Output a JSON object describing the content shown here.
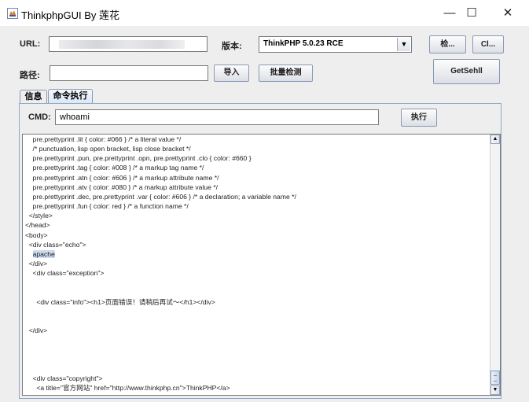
{
  "window": {
    "title": "ThinkphpGUI By 莲花",
    "minimize_glyph": "—",
    "maximize_glyph": "☐",
    "close_glyph": "✕"
  },
  "form": {
    "url_label": "URL:",
    "url_value": "",
    "version_label": "版本:",
    "version_selected": "ThinkPHP 5.0.23 RCE",
    "check_button": "检...",
    "clear_button": "Cl...",
    "path_label": "路径:",
    "path_value": "",
    "import_button": "导入",
    "batch_button": "批量检测",
    "getshell_button": "GetSehll"
  },
  "tabs": [
    {
      "label": "信息",
      "active": false
    },
    {
      "label": "命令执行",
      "active": true
    }
  ],
  "cmd": {
    "label": "CMD:",
    "value": "whoami",
    "exec_button": "执行"
  },
  "output": {
    "before_highlight": "    pre.prettyprint .lit { color: #066 } /* a literal value */\n    /* punctuation, lisp open bracket, lisp close bracket */\n    pre.prettyprint .pun, pre.prettyprint .opn, pre.prettyprint .clo { color: #660 }\n    pre.prettyprint .tag { color: #008 } /* a markup tag name */\n    pre.prettyprint .atn { color: #606 } /* a markup attribute name */\n    pre.prettyprint .atv { color: #080 } /* a markup attribute value */\n    pre.prettyprint .dec, pre.prettyprint .var { color: #606 } /* a declaration; a variable name */\n    pre.prettyprint .fun { color: red } /* a function name */\n  </style>\n</head>\n<body>\n  <div class=\"echo\">\n    ",
    "highlight": "apache",
    "after_highlight": "\n  </div>\n    <div class=\"exception\">\n\n\n      <div class=\"info\"><h1>页面错误！请稍后再试～</h1></div>\n\n\n  </div>\n\n\n\n\n    <div class=\"copyright\">\n      <a title=\"官方网站\" href=\"http://www.thinkphp.cn\">ThinkPHP</a>"
  },
  "icons": {
    "app": "java-cup-icon",
    "scroll_up": "▲",
    "scroll_down": "▼",
    "dropdown": "▼"
  }
}
